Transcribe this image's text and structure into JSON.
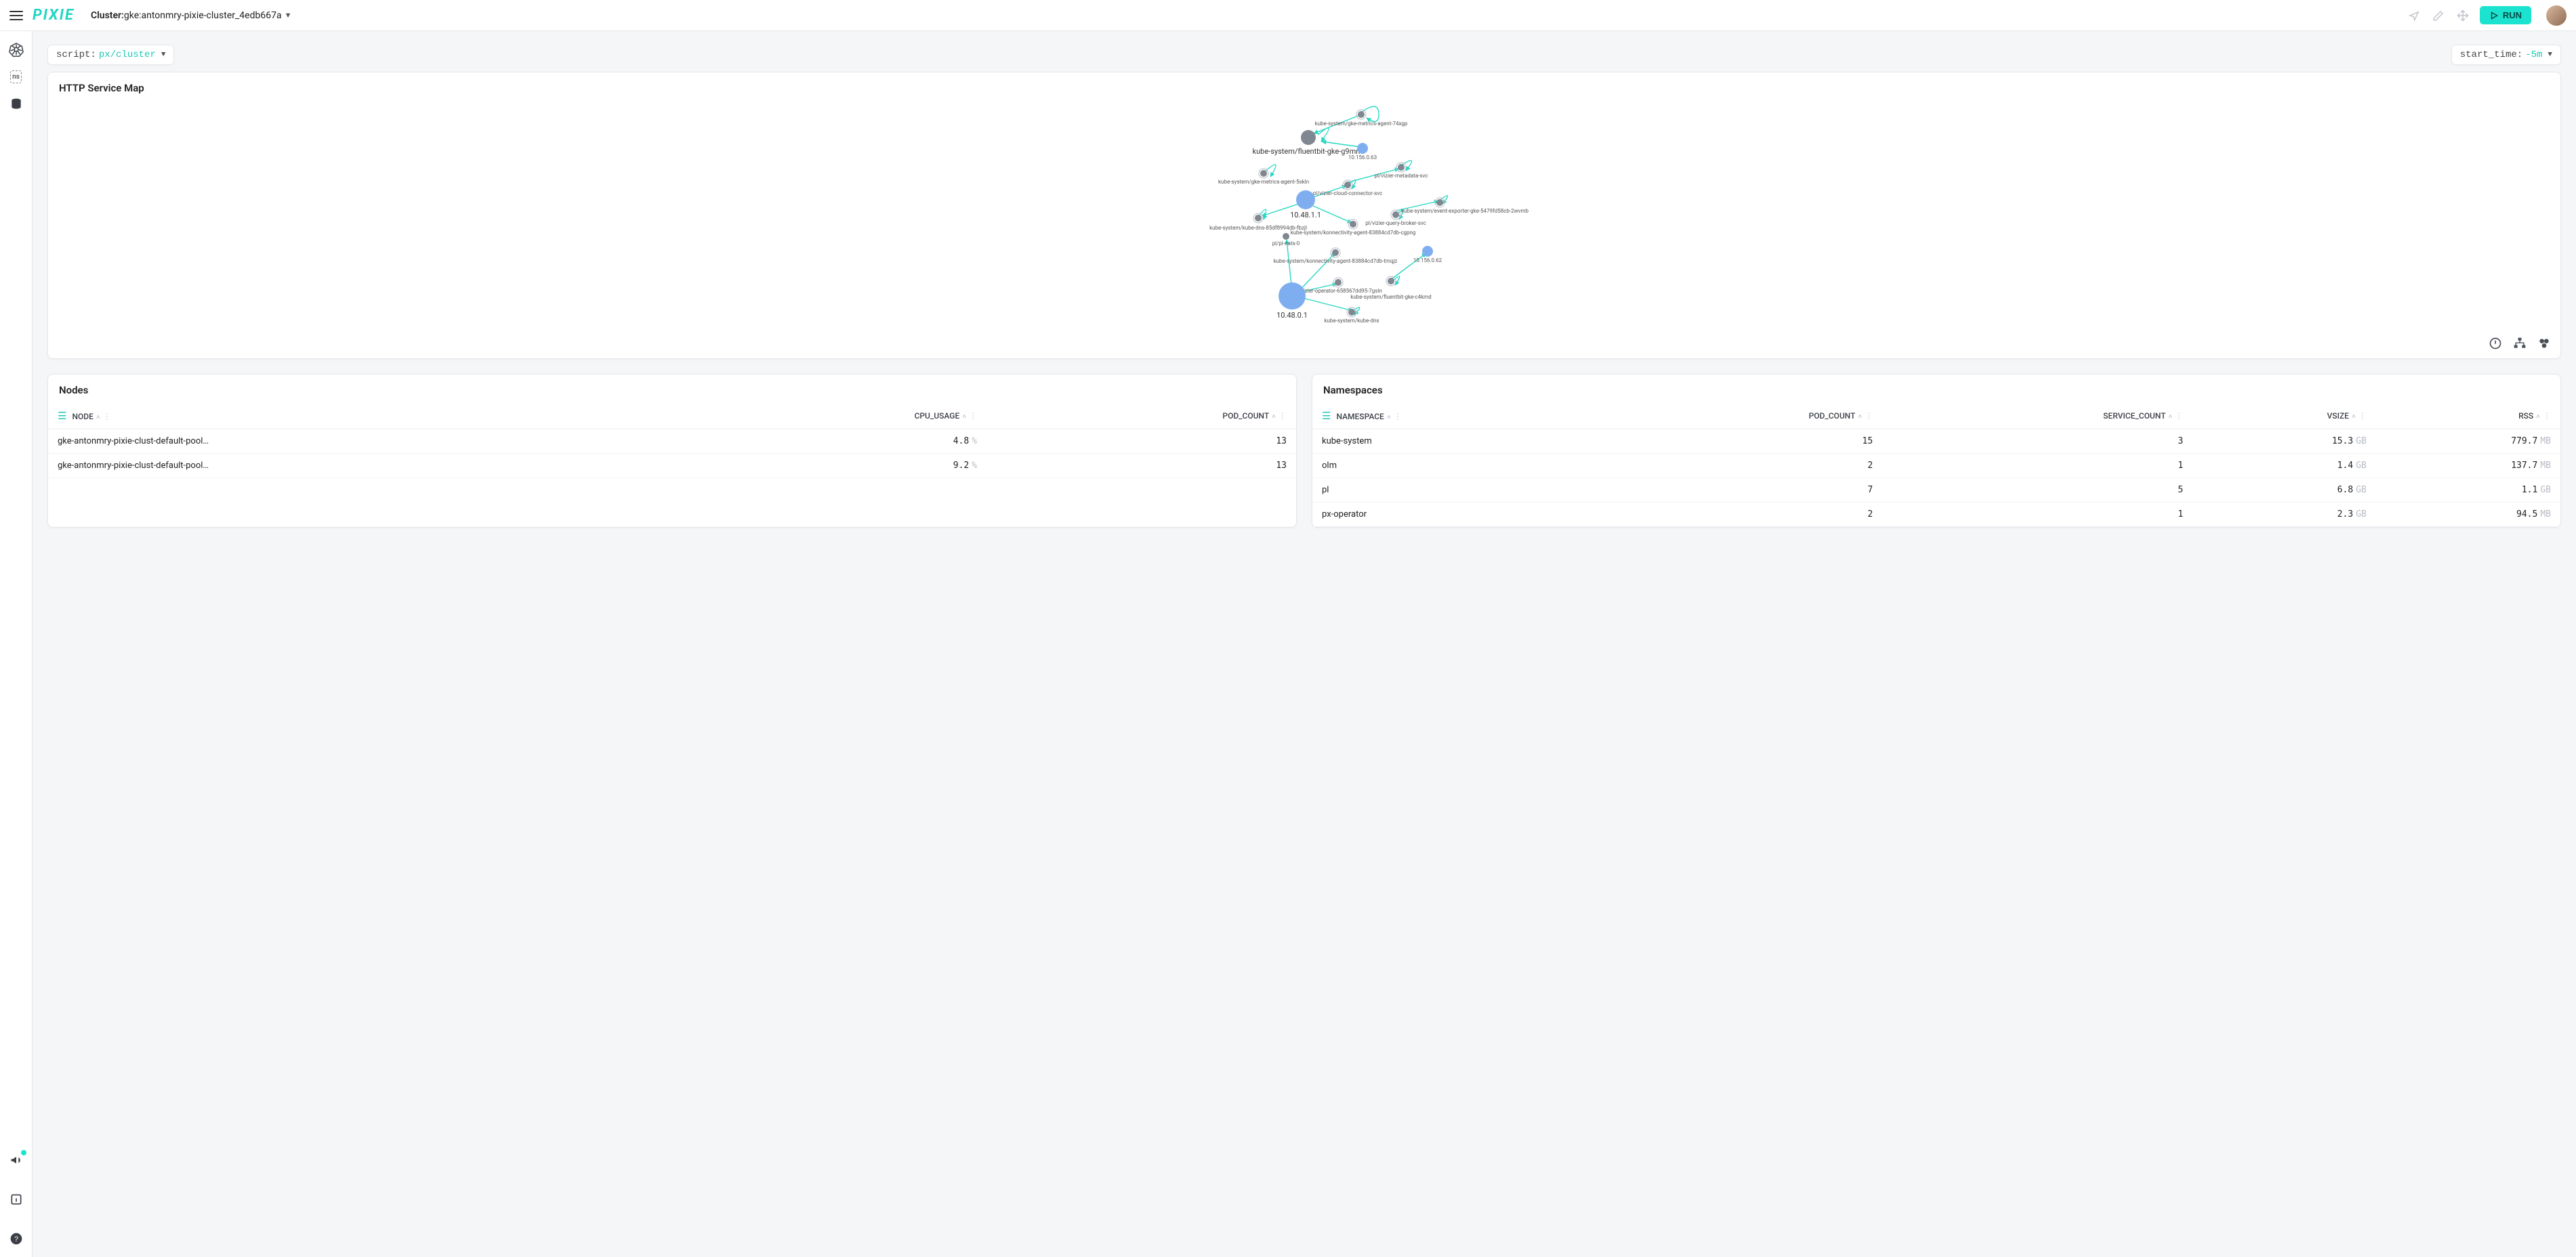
{
  "header": {
    "logo_text": "PIXIE",
    "cluster_label": "Cluster: ",
    "cluster_name": "gke:antonmry-pixie-cluster_4edb667a",
    "run_label": "RUN"
  },
  "controls": {
    "script_key": "script: ",
    "script_val": "px/cluster",
    "start_time_key": "start_time: ",
    "start_time_val": "-5m"
  },
  "sidebar_ns_label": "ns",
  "httpmap": {
    "title": "HTTP Service Map",
    "nodes": {
      "gke_metrics_74xgp": "kube-system/gke-metrics-agent-74xgp",
      "fluentbit_g9mn9": "kube-system/fluentbit-gke-g9mn9",
      "ip_10_156_0_63": "10.156.0.63",
      "gke_metrics_5skln": "kube-system/gke-metrics-agent-5skln",
      "vizier_metadata": "pl/vizier-metadata-svc",
      "vizier_cloud_connector": "pl/vizier-cloud-connector-svc",
      "ip_10_48_1_1": "10.48.1.1",
      "kube_dns_fbzjl": "kube-system/kube-dns-85df8994db-fbzjl",
      "event_exporter": "kube-system/event-exporter-gke-5479fd58cb-2wvmb",
      "vizier_query_broker": "pl/vizier-query-broker-svc",
      "konnectivity_cgpng": "kube-system/konnectivity-agent-83884cd7db-cgpng",
      "pl_pl": "pl/pl-nats-0",
      "konnectivity_tmqjz": "kube-system/konnectivity-agent-83884cd7db-tmqjz",
      "ip_10_156_0_62": "10.156.0.62",
      "vizier_operator": "pl/vizier-operator-658567dd95-7gsln",
      "fluentbit_c4kmd": "kube-system/fluentbit-gke-c4kmd",
      "ip_10_48_0_1": "10.48.0.1",
      "kube_dns": "kube-system/kube-dns"
    }
  },
  "nodes_table": {
    "title": "Nodes",
    "cols": {
      "node": "NODE",
      "cpu": "CPU_USAGE",
      "pods": "POD_COUNT"
    },
    "rows": [
      {
        "node": "gke-antonmry-pixie-clust-default-pool…",
        "cpu_val": "4.8",
        "cpu_unit": "%",
        "pods": "13"
      },
      {
        "node": "gke-antonmry-pixie-clust-default-pool…",
        "cpu_val": "9.2",
        "cpu_unit": "%",
        "pods": "13"
      }
    ]
  },
  "ns_table": {
    "title": "Namespaces",
    "cols": {
      "ns": "NAMESPACE",
      "pods": "POD_COUNT",
      "svc": "SERVICE_COUNT",
      "vsize": "VSIZE",
      "rss": "RSS"
    },
    "rows": [
      {
        "ns": "kube-system",
        "pods": "15",
        "svc": "3",
        "vsize_val": "15.3",
        "vsize_unit": "GB",
        "rss_val": "779.7",
        "rss_unit": "MB"
      },
      {
        "ns": "olm",
        "pods": "2",
        "svc": "1",
        "vsize_val": "1.4",
        "vsize_unit": "GB",
        "rss_val": "137.7",
        "rss_unit": "MB"
      },
      {
        "ns": "pl",
        "pods": "7",
        "svc": "5",
        "vsize_val": "6.8",
        "vsize_unit": "GB",
        "rss_val": "1.1",
        "rss_unit": "GB"
      },
      {
        "ns": "px-operator",
        "pods": "2",
        "svc": "1",
        "vsize_val": "2.3",
        "vsize_unit": "GB",
        "rss_val": "94.5",
        "rss_unit": "MB"
      }
    ]
  }
}
